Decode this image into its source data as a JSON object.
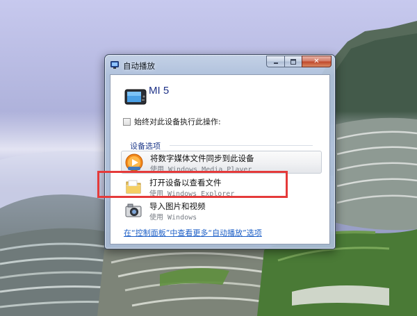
{
  "window": {
    "title": "自动播放",
    "caption_buttons": {
      "close_glyph": "✕"
    }
  },
  "device": {
    "name": "MI 5",
    "icon": "media-player-device-icon"
  },
  "always_do": {
    "label": "始终对此设备执行此操作:",
    "checked": false
  },
  "group": {
    "label": "设备选项"
  },
  "options": [
    {
      "title": "将数字媒体文件同步到此设备",
      "subtitle": "使用 Windows Media Player",
      "icon": "media-player-icon",
      "highlighted": false
    },
    {
      "title": "打开设备以查看文件",
      "subtitle": "使用 Windows Explorer",
      "icon": "folder-icon",
      "highlighted": true
    },
    {
      "title": "导入图片和视频",
      "subtitle": "使用 Windows",
      "icon": "camera-icon",
      "highlighted": false
    }
  ],
  "more_link": "在“控制面板”中查看更多“自动播放”选项",
  "colors": {
    "annotation": "#e53a3a",
    "link": "#1d5fc7",
    "heading": "#1e3a8a"
  }
}
